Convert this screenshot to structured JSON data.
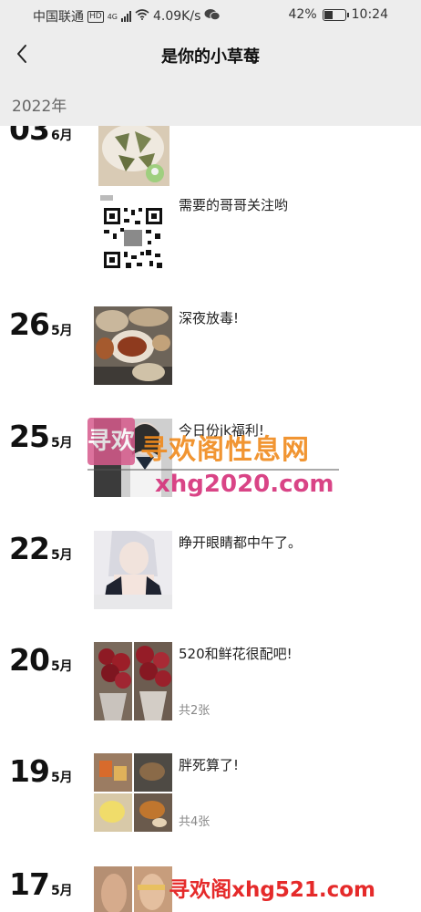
{
  "status": {
    "carrier": "中国联通",
    "hd": "HD",
    "network": "4G",
    "speed": "4.09K/s",
    "battery": "42%",
    "battery_level": 0.42,
    "time": "10:24"
  },
  "header": {
    "title": "是你的小草莓",
    "back_icon": "chevron-left-icon"
  },
  "year": "2022年",
  "posts": [
    {
      "day": "03",
      "month": "6月",
      "caption": "",
      "count": ""
    },
    {
      "day": "",
      "month": "",
      "caption": "需要的哥哥关注哟",
      "count": ""
    },
    {
      "day": "26",
      "month": "5月",
      "caption": "深夜放毒!",
      "count": ""
    },
    {
      "day": "25",
      "month": "5月",
      "caption": "今日份jk福利!",
      "count": ""
    },
    {
      "day": "22",
      "month": "5月",
      "caption": "睁开眼睛都中午了。",
      "count": ""
    },
    {
      "day": "20",
      "month": "5月",
      "caption": "520和鲜花很配吧!",
      "count": "共2张"
    },
    {
      "day": "19",
      "month": "5月",
      "caption": "胖死算了!",
      "count": "共4张"
    },
    {
      "day": "17",
      "month": "5月",
      "caption": "",
      "count": ""
    }
  ],
  "watermarks": {
    "logo_text": "寻欢",
    "site_name": "寻欢阁性息网",
    "site_url": "xhg2020.com",
    "bottom": "寻欢阁xhg521.com"
  },
  "colors": {
    "bar_bg": "#ededed",
    "wm_orange": "#f08a1c",
    "wm_pink": "#d5307a",
    "wm_red": "#e52a2a"
  }
}
